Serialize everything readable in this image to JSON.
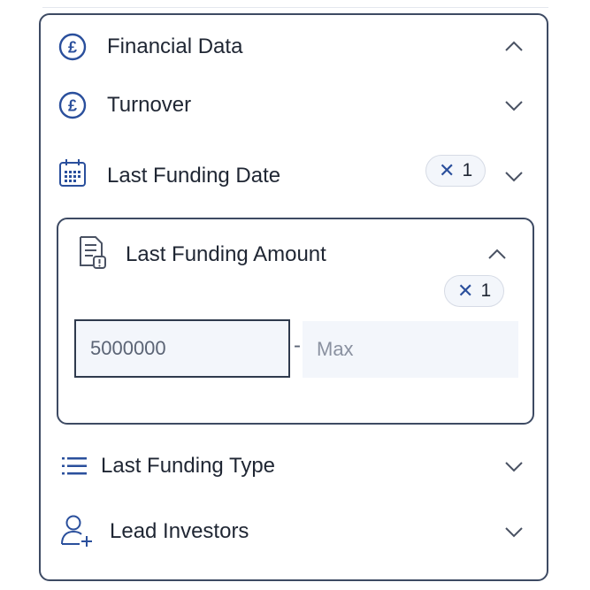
{
  "panel": {
    "financial_data": {
      "label": "Financial Data",
      "icon": "pound-icon",
      "expanded": true
    },
    "turnover": {
      "label": "Turnover",
      "icon": "pound-icon"
    },
    "last_funding_date": {
      "label": "Last Funding Date",
      "icon": "calendar-icon",
      "badge_x": "✕",
      "badge_count": "1"
    },
    "last_funding_amount": {
      "label": "Last Funding Amount",
      "icon": "document-alert-icon",
      "badge_x": "✕",
      "badge_count": "1",
      "min_value": "5000000",
      "separator": "-",
      "max_placeholder": "Max"
    },
    "last_funding_type": {
      "label": "Last Funding Type",
      "icon": "list-icon"
    },
    "lead_investors": {
      "label": "Lead Investors",
      "icon": "user-add-icon"
    }
  },
  "colors": {
    "accent": "#2a4f9c",
    "border": "#3d4a63",
    "text": "#1f2633",
    "input_bg": "#f3f6fb"
  }
}
